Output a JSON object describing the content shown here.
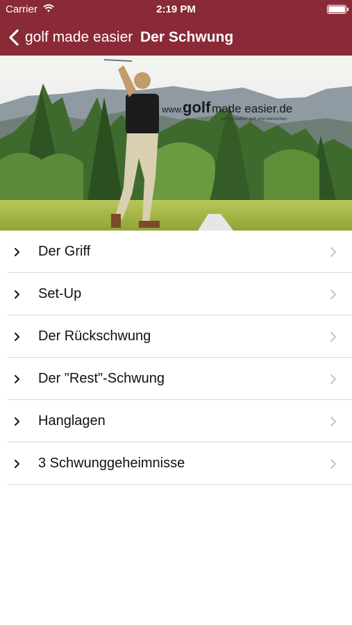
{
  "status_bar": {
    "carrier": "Carrier",
    "time": "2:19 PM"
  },
  "nav": {
    "back_label": "golf made easier",
    "title": "Der Schwung",
    "bar_color": "#8a2a36"
  },
  "hero": {
    "url_prefix": "www.",
    "brand_bold": "golf",
    "brand_rest": " made easier.de",
    "tagline": "wir verstehen golf und menschen"
  },
  "menu": {
    "items": [
      {
        "label": "Der Griff"
      },
      {
        "label": "Set-Up"
      },
      {
        "label": "Der Rückschwung"
      },
      {
        "label": "Der \"Rest\"-Schwung"
      },
      {
        "label": "Hanglagen"
      },
      {
        "label": "3 Schwunggeheimnisse"
      }
    ]
  }
}
